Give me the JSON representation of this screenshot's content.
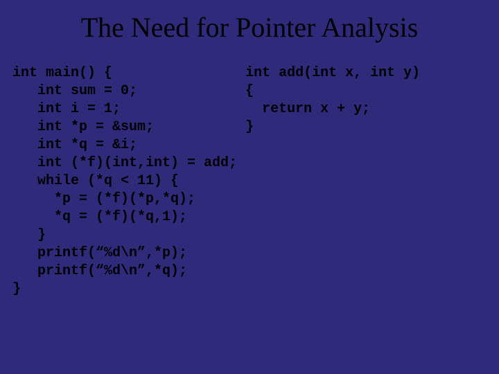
{
  "title": "The Need for Pointer Analysis",
  "code_left": "int main() {\n   int sum = 0;\n   int i = 1;\n   int *p = &sum;\n   int *q = &i;\n   int (*f)(int,int) = add;\n   while (*q < 11) {\n     *p = (*f)(*p,*q);\n     *q = (*f)(*q,1);\n   }\n   printf(“%d\\n”,*p);\n   printf(“%d\\n”,*q);\n}",
  "code_right": "int add(int x, int y)\n{\n  return x + y;\n}"
}
